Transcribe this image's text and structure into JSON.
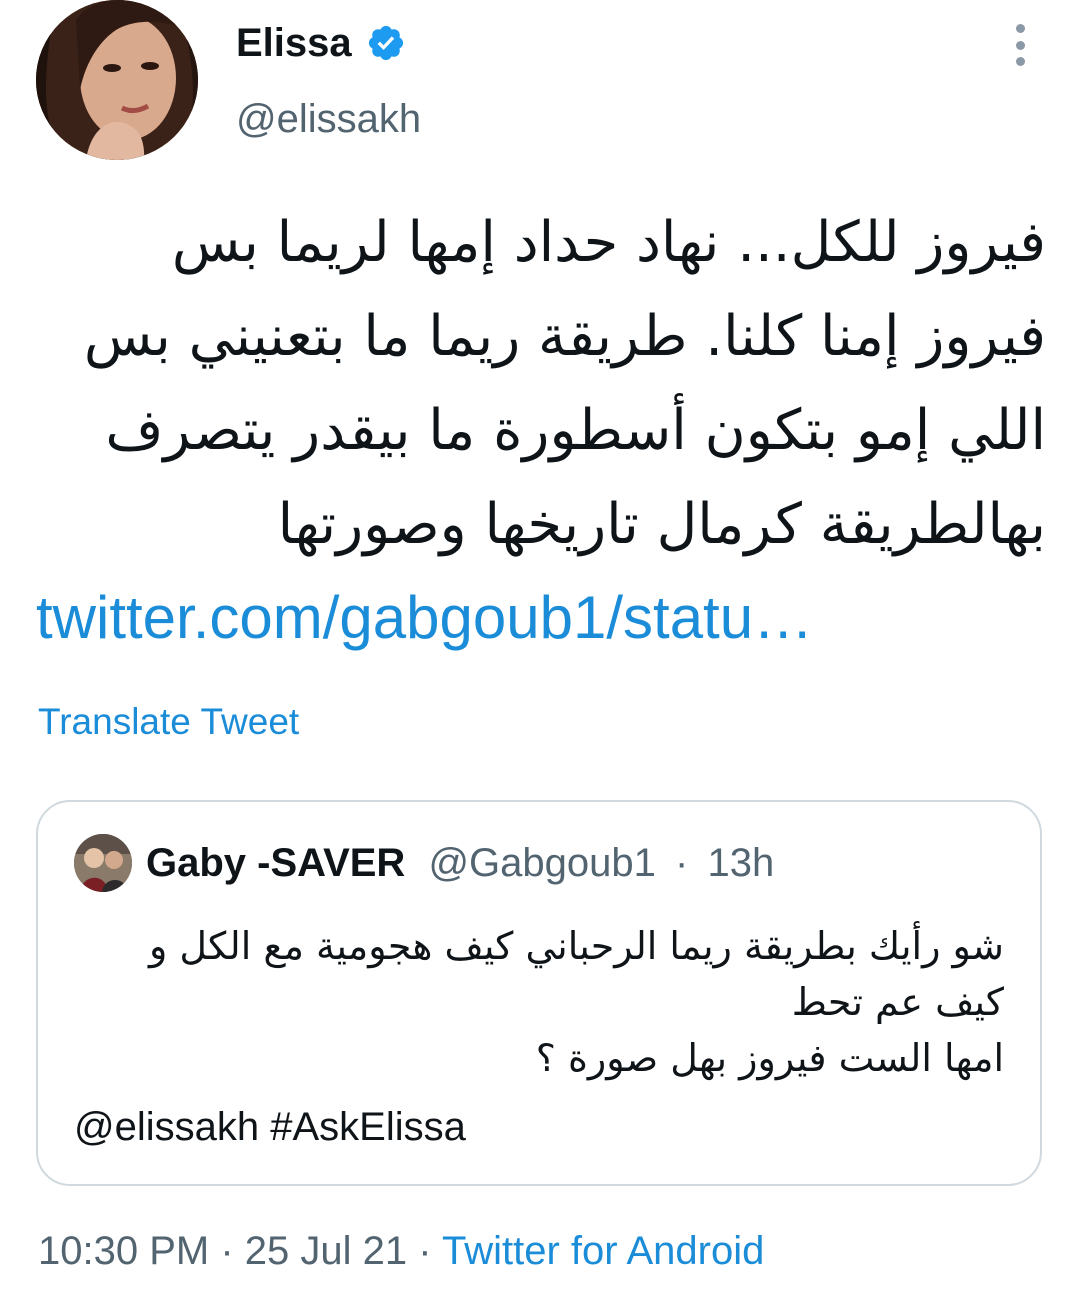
{
  "author": {
    "name": "Elissa",
    "handle": "@elissakh",
    "verified": true
  },
  "tweet": {
    "text_lines": [
      "فيروز للكل... نهاد حداد إمها لريما بس",
      "فيروز إمنا كلنا. طريقة ريما ما بتعنيني بس",
      "اللي إمو بتكون أسطورة ما بيقدر يتصرف",
      "بهالطريقة كرمال تاريخها وصورتها"
    ],
    "link": "twitter.com/gabgoub1/statu…",
    "translate_label": "Translate Tweet"
  },
  "quoted": {
    "name": "Gaby -SAVER",
    "handle": "@Gabgoub1",
    "separator": "·",
    "time": "13h",
    "text_lines": [
      "شو رأيك بطريقة ريما الرحباني كيف هجومية مع الكل و",
      "كيف عم تحط",
      "امها الست فيروز بهل صورة ؟"
    ],
    "mentions": "@elissakh #AskElissa"
  },
  "footer": {
    "time": "10:30 PM",
    "sep1": "·",
    "date": "25 Jul 21",
    "sep2": "·",
    "source": "Twitter for Android"
  },
  "colors": {
    "link": "#1a8cd8",
    "muted": "#536471",
    "verified": "#1d9bf0",
    "border": "#cfd9de"
  },
  "icons": {
    "verified": "verified-badge-icon",
    "more": "more-options-icon"
  }
}
